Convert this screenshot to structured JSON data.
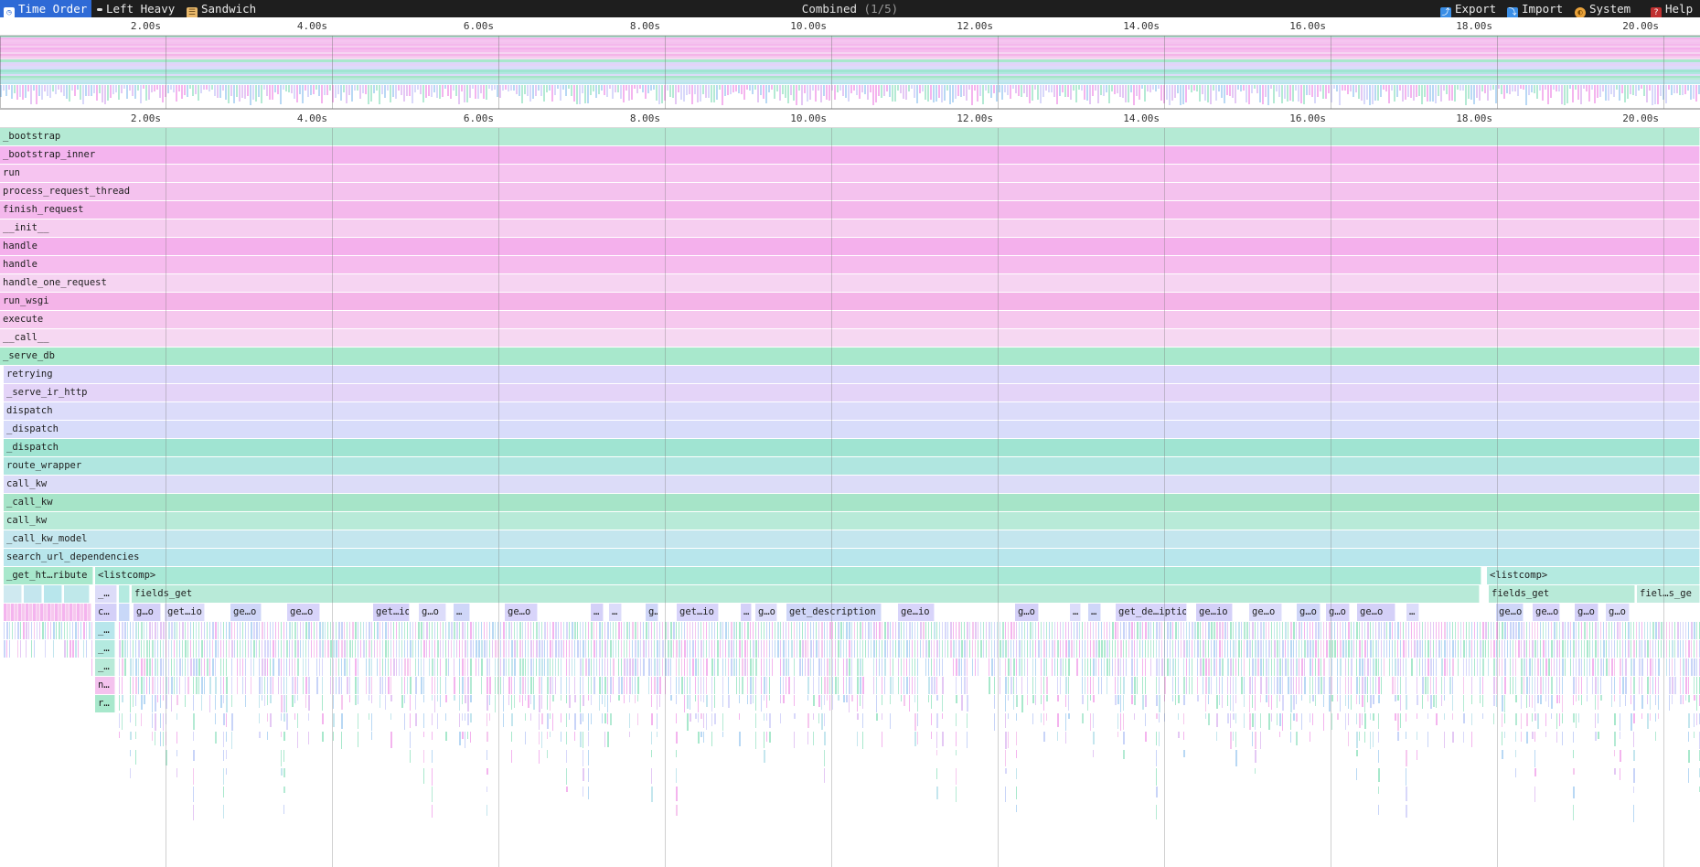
{
  "toolbar": {
    "tabs": [
      {
        "label": "Time Order",
        "icon": "time-order-icon",
        "active": true
      },
      {
        "label": "Left Heavy",
        "icon": "left-heavy-icon",
        "active": false
      },
      {
        "label": "Sandwich",
        "icon": "sandwich-icon",
        "active": false
      }
    ],
    "title": "Combined",
    "profile_count": "(1/5)",
    "actions": [
      {
        "label": "Export",
        "icon": "export-icon"
      },
      {
        "label": "Import",
        "icon": "import-icon"
      },
      {
        "label": "System",
        "icon": "system-theme-icon"
      },
      {
        "label": "Help",
        "icon": "help-icon"
      }
    ]
  },
  "ruler_ticks": [
    "2.00s",
    "4.00s",
    "6.00s",
    "8.00s",
    "10.00s",
    "12.00s",
    "14.00s",
    "16.00s",
    "18.00s",
    "20.00s"
  ],
  "flame": {
    "stack": [
      {
        "name": "_bootstrap",
        "color": "#b4ead4"
      },
      {
        "name": "_bootstrap_inner",
        "color": "#f4b4ee"
      },
      {
        "name": "run",
        "color": "#f6c4f0"
      },
      {
        "name": "process_request_thread",
        "color": "#f4c2ee"
      },
      {
        "name": "finish_request",
        "color": "#f4b8ec"
      },
      {
        "name": "__init__",
        "color": "#f6cef0"
      },
      {
        "name": "handle",
        "color": "#f4b0ec"
      },
      {
        "name": "handle",
        "color": "#f6bcee"
      },
      {
        "name": "handle_one_request",
        "color": "#f6d4f2"
      },
      {
        "name": "run_wsgi",
        "color": "#f4b4e8"
      },
      {
        "name": "execute",
        "color": "#f6c8ee"
      },
      {
        "name": "__call__",
        "color": "#f6d8f2"
      },
      {
        "name": "_serve_db",
        "color": "#a8e8cc"
      },
      {
        "name": "retrying",
        "color": "#dcd8fa"
      },
      {
        "name": "_serve_ir_http",
        "color": "#e4d4f8"
      },
      {
        "name": "dispatch",
        "color": "#dcdcfa"
      },
      {
        "name": "_dispatch",
        "color": "#d8dcfa"
      },
      {
        "name": "_dispatch",
        "color": "#a0e4d2"
      },
      {
        "name": "route_wrapper",
        "color": "#b0e6e0"
      },
      {
        "name": "call_kw",
        "color": "#dcdcf8"
      },
      {
        "name": "_call_kw",
        "color": "#a6e4c8"
      },
      {
        "name": "call_kw",
        "color": "#b8ead8"
      },
      {
        "name": "_call_kw_model",
        "color": "#c4e6ee"
      },
      {
        "name": "search_url_dependencies",
        "color": "#b8e6ec"
      }
    ],
    "level_24": [
      {
        "name": "_get_ht…ribute",
        "color": "#a8e8cc"
      },
      {
        "name": "<listcomp>",
        "color": "#a8e8d6"
      },
      {
        "name": "<listcomp>",
        "color": "#b4eae0"
      }
    ],
    "level_25": [
      {
        "name": "_…",
        "color": "#dcdcf8"
      },
      {
        "name": "fields_get",
        "color": "#b8ead8"
      },
      {
        "name": "fields_get",
        "color": "#b8ead8"
      },
      {
        "name": "fiel…s_ge",
        "color": "#c4ece0"
      }
    ],
    "level_26": [
      {
        "name": "c…",
        "color": "#d4d0f8"
      },
      {
        "name": "g…o"
      },
      {
        "name": "get…io"
      },
      {
        "name": "ge…o"
      },
      {
        "name": "ge…o"
      },
      {
        "name": "get…io"
      },
      {
        "name": "g…o"
      },
      {
        "name": "…"
      },
      {
        "name": "ge…o"
      },
      {
        "name": "…"
      },
      {
        "name": "…"
      },
      {
        "name": "g…"
      },
      {
        "name": "get…io"
      },
      {
        "name": "…"
      },
      {
        "name": "g…o"
      },
      {
        "name": "get_description"
      },
      {
        "name": "ge…io"
      },
      {
        "name": "g…o"
      },
      {
        "name": "…"
      },
      {
        "name": "…"
      },
      {
        "name": "get_de…iptio"
      },
      {
        "name": "ge…io"
      },
      {
        "name": "ge…o"
      },
      {
        "name": "g…o"
      },
      {
        "name": "g…o"
      },
      {
        "name": "ge…o"
      },
      {
        "name": "…"
      },
      {
        "name": "ge…o"
      },
      {
        "name": "ge…o"
      },
      {
        "name": "g…o"
      },
      {
        "name": "g…o"
      }
    ],
    "column_labels": [
      "_…",
      "_…",
      "_…",
      "n…",
      "r…"
    ]
  },
  "palette": {
    "mint": "#b4ead4",
    "pink": "#f4b4ee",
    "lavender": "#d8d8fa",
    "blue": "#b8d8f4",
    "accent": "#2e6ad6",
    "toolbar_bg": "#1e1e1e"
  }
}
